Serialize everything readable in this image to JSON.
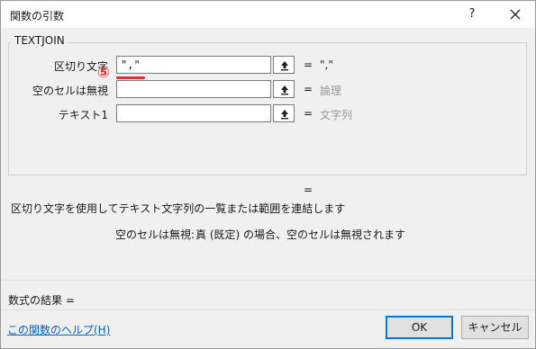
{
  "window": {
    "title": "関数の引数",
    "help_label": "?"
  },
  "function_name": "TEXTJOIN",
  "arguments": [
    {
      "label": "区切り文字",
      "value": "\",\"",
      "equals": "=",
      "result": "\",\""
    },
    {
      "label": "空のセルは無視",
      "value": "",
      "equals": "=",
      "result": "論理"
    },
    {
      "label": "テキスト1",
      "value": "",
      "equals": "=",
      "result": "文字列"
    }
  ],
  "annotation": {
    "marker": "⑤",
    "color": "#e03030"
  },
  "formula_result_eq": "=",
  "description": "区切り文字を使用してテキスト文字列の一覧または範囲を連結します",
  "arg_description": {
    "name": "空のセルは無視:",
    "text": "真 (既定) の場合、空のセルは無視されます"
  },
  "result_label": "数式の結果 =",
  "help_link": "この関数のヘルプ(H)",
  "buttons": {
    "ok": "OK",
    "cancel": "キャンセル"
  },
  "colors": {
    "focus": "#0078d7",
    "link": "#0563c1",
    "dim_text": "#9a9a9a"
  }
}
